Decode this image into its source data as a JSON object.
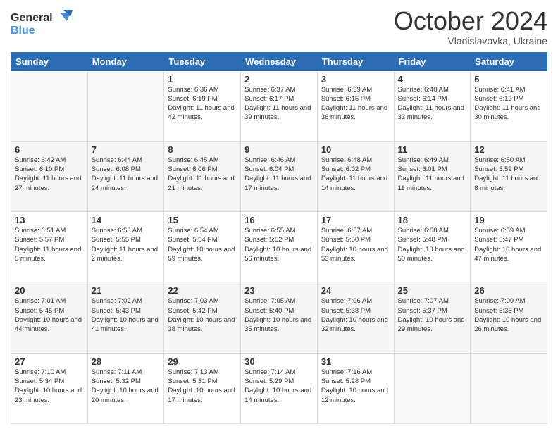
{
  "logo": {
    "line1": "General",
    "line2": "Blue"
  },
  "header": {
    "month": "October 2024",
    "location": "Vladislavovka, Ukraine"
  },
  "days_of_week": [
    "Sunday",
    "Monday",
    "Tuesday",
    "Wednesday",
    "Thursday",
    "Friday",
    "Saturday"
  ],
  "weeks": [
    [
      {
        "day": "",
        "info": ""
      },
      {
        "day": "",
        "info": ""
      },
      {
        "day": "1",
        "info": "Sunrise: 6:36 AM\nSunset: 6:19 PM\nDaylight: 11 hours and 42 minutes."
      },
      {
        "day": "2",
        "info": "Sunrise: 6:37 AM\nSunset: 6:17 PM\nDaylight: 11 hours and 39 minutes."
      },
      {
        "day": "3",
        "info": "Sunrise: 6:39 AM\nSunset: 6:15 PM\nDaylight: 11 hours and 36 minutes."
      },
      {
        "day": "4",
        "info": "Sunrise: 6:40 AM\nSunset: 6:14 PM\nDaylight: 11 hours and 33 minutes."
      },
      {
        "day": "5",
        "info": "Sunrise: 6:41 AM\nSunset: 6:12 PM\nDaylight: 11 hours and 30 minutes."
      }
    ],
    [
      {
        "day": "6",
        "info": "Sunrise: 6:42 AM\nSunset: 6:10 PM\nDaylight: 11 hours and 27 minutes."
      },
      {
        "day": "7",
        "info": "Sunrise: 6:44 AM\nSunset: 6:08 PM\nDaylight: 11 hours and 24 minutes."
      },
      {
        "day": "8",
        "info": "Sunrise: 6:45 AM\nSunset: 6:06 PM\nDaylight: 11 hours and 21 minutes."
      },
      {
        "day": "9",
        "info": "Sunrise: 6:46 AM\nSunset: 6:04 PM\nDaylight: 11 hours and 17 minutes."
      },
      {
        "day": "10",
        "info": "Sunrise: 6:48 AM\nSunset: 6:02 PM\nDaylight: 11 hours and 14 minutes."
      },
      {
        "day": "11",
        "info": "Sunrise: 6:49 AM\nSunset: 6:01 PM\nDaylight: 11 hours and 11 minutes."
      },
      {
        "day": "12",
        "info": "Sunrise: 6:50 AM\nSunset: 5:59 PM\nDaylight: 11 hours and 8 minutes."
      }
    ],
    [
      {
        "day": "13",
        "info": "Sunrise: 6:51 AM\nSunset: 5:57 PM\nDaylight: 11 hours and 5 minutes."
      },
      {
        "day": "14",
        "info": "Sunrise: 6:53 AM\nSunset: 5:55 PM\nDaylight: 11 hours and 2 minutes."
      },
      {
        "day": "15",
        "info": "Sunrise: 6:54 AM\nSunset: 5:54 PM\nDaylight: 10 hours and 59 minutes."
      },
      {
        "day": "16",
        "info": "Sunrise: 6:55 AM\nSunset: 5:52 PM\nDaylight: 10 hours and 56 minutes."
      },
      {
        "day": "17",
        "info": "Sunrise: 6:57 AM\nSunset: 5:50 PM\nDaylight: 10 hours and 53 minutes."
      },
      {
        "day": "18",
        "info": "Sunrise: 6:58 AM\nSunset: 5:48 PM\nDaylight: 10 hours and 50 minutes."
      },
      {
        "day": "19",
        "info": "Sunrise: 6:59 AM\nSunset: 5:47 PM\nDaylight: 10 hours and 47 minutes."
      }
    ],
    [
      {
        "day": "20",
        "info": "Sunrise: 7:01 AM\nSunset: 5:45 PM\nDaylight: 10 hours and 44 minutes."
      },
      {
        "day": "21",
        "info": "Sunrise: 7:02 AM\nSunset: 5:43 PM\nDaylight: 10 hours and 41 minutes."
      },
      {
        "day": "22",
        "info": "Sunrise: 7:03 AM\nSunset: 5:42 PM\nDaylight: 10 hours and 38 minutes."
      },
      {
        "day": "23",
        "info": "Sunrise: 7:05 AM\nSunset: 5:40 PM\nDaylight: 10 hours and 35 minutes."
      },
      {
        "day": "24",
        "info": "Sunrise: 7:06 AM\nSunset: 5:38 PM\nDaylight: 10 hours and 32 minutes."
      },
      {
        "day": "25",
        "info": "Sunrise: 7:07 AM\nSunset: 5:37 PM\nDaylight: 10 hours and 29 minutes."
      },
      {
        "day": "26",
        "info": "Sunrise: 7:09 AM\nSunset: 5:35 PM\nDaylight: 10 hours and 26 minutes."
      }
    ],
    [
      {
        "day": "27",
        "info": "Sunrise: 7:10 AM\nSunset: 5:34 PM\nDaylight: 10 hours and 23 minutes."
      },
      {
        "day": "28",
        "info": "Sunrise: 7:11 AM\nSunset: 5:32 PM\nDaylight: 10 hours and 20 minutes."
      },
      {
        "day": "29",
        "info": "Sunrise: 7:13 AM\nSunset: 5:31 PM\nDaylight: 10 hours and 17 minutes."
      },
      {
        "day": "30",
        "info": "Sunrise: 7:14 AM\nSunset: 5:29 PM\nDaylight: 10 hours and 14 minutes."
      },
      {
        "day": "31",
        "info": "Sunrise: 7:16 AM\nSunset: 5:28 PM\nDaylight: 10 hours and 12 minutes."
      },
      {
        "day": "",
        "info": ""
      },
      {
        "day": "",
        "info": ""
      }
    ]
  ]
}
